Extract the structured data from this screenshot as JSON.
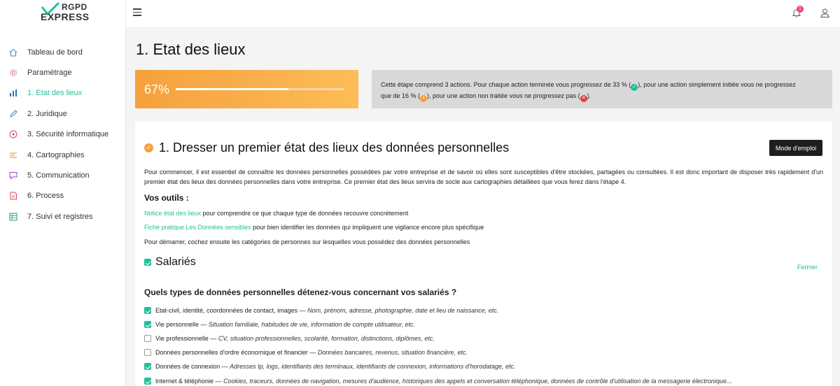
{
  "logo": {
    "line1": "RGPD",
    "line2": "EXPRESS"
  },
  "sidebar": {
    "items": [
      {
        "label": "Tableau de bord",
        "icon": "home-icon",
        "active": false
      },
      {
        "label": "Paramétrage",
        "icon": "gear-icon",
        "active": false
      },
      {
        "label": "1. Etat des lieux",
        "icon": "bar-chart-icon",
        "active": true
      },
      {
        "label": "2. Juridique",
        "icon": "pencil-icon",
        "active": false
      },
      {
        "label": "3. Sécurité informatique",
        "icon": "security-icon",
        "active": false
      },
      {
        "label": "4. Cartographies",
        "icon": "map-icon",
        "active": false
      },
      {
        "label": "5. Communication",
        "icon": "chat-icon",
        "active": false
      },
      {
        "label": "6. Process",
        "icon": "document-icon",
        "active": false
      },
      {
        "label": "7. Suivi et registres",
        "icon": "table-icon",
        "active": false
      }
    ]
  },
  "topbar": {
    "notification_count": "1"
  },
  "page": {
    "title": "1. Etat des lieux",
    "progress_label": "67%",
    "progress_value": 0.67,
    "info_part1": "Cette étape comprend 3 actions. Pour chaque action terminée vous progressez de 33 % (",
    "info_part2": "), pour une action simplement initiée vous ne progressez",
    "info_part3": "que de 16 % (",
    "info_part4": "), pour une action non traitée vous ne progressez pas (",
    "info_part5": ")."
  },
  "section": {
    "title": "1. Dresser un premier état des lieux des données personnelles",
    "mode_button": "Mode d'emploi",
    "intro": "Pour commencer, il est essentiel de connaître les données personnelles possédées par votre entreprise et de savoir où elles sont susceptibles d'être stockées, partagées ou consultées. Il est donc important de disposer très rapidement d'un premier état des lieux des données personnelles dans votre entreprise. Ce premier état des lieux servira de socle aux cartographies détaillées que vous ferez dans l'étape 4.",
    "outils_title": "Vos outils :",
    "tool1_link": "Notice état des lieux",
    "tool1_text": " pour comprendre ce que chaque type de données recouvre concrètement",
    "tool2_link": "Fiche pratique Les Données sensibles",
    "tool2_text": " pour bien identifier les données qui impliquent une vigilance encore plus spécifique",
    "start_text": "Pour démarrer, cochez ensuite les catégories de personnes sur lesquelles vous possédez des données personnelles",
    "category_label": "Salariés",
    "close_label": "Fermer",
    "question": "Quels types de données personnelles détenez-vous concernant vos salariés ?",
    "options": [
      {
        "label": "Etat-civil, identité, coordonnées de contact, images — ",
        "desc": "Nom, prénom, adresse, photographie, date et lieu de naissance, etc.",
        "checked": true
      },
      {
        "label": "Vie personnelle — ",
        "desc": "Situation familiale, habitudes de vie, information de compte utilisateur, etc.",
        "checked": true
      },
      {
        "label": "Vie professionnelle — ",
        "desc": "CV, situation professionnelles, scolarité, formation, distinctions, diplômes, etc.",
        "checked": false
      },
      {
        "label": "Données personnelles d'ordre économique et financier — ",
        "desc": "Données bancaires, revenus, situation financière, etc.",
        "checked": false
      },
      {
        "label": "Données de connexion — ",
        "desc": "Adresses Ip, logs, identifiants des terminaux, identifiants de connexion, informations d'horodatage, etc.",
        "checked": true
      },
      {
        "label": "Internet & téléphonie — ",
        "desc": "Cookies, traceurs, données de navigation, mesures d'audience, historiques des appels et conversation téléphonique, données de contrôle d'utilisation de la messagerie électronique...",
        "checked": true
      }
    ]
  },
  "colors": {
    "accent": "#1fc09a",
    "orange": "#f5a13d",
    "red": "#e23b3b"
  }
}
